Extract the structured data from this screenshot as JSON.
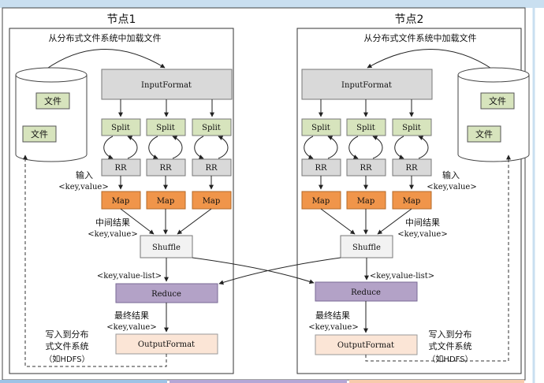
{
  "colors": {
    "header_band": "#c9dff0",
    "split_fill": "#d7e4bd",
    "rr_fill": "#d9d9d9",
    "map_fill": "#f0954a",
    "shuffle_fill": "#f2f2f2",
    "reduce_fill": "#b3a2c7",
    "output_fill": "#fbe5d6",
    "inputformat_fill": "#d9d9d9",
    "file_fill": "#d7e4bd",
    "footer_bands": [
      "#9dc3e6",
      "#b4a7d6",
      "#f8cbad"
    ]
  },
  "node1": {
    "title": "节点1",
    "load_label": "从分布式文件系统中加载文件",
    "inputformat": "InputFormat",
    "files": [
      "文件",
      "文件"
    ],
    "splits": [
      "Split",
      "Split",
      "Split"
    ],
    "rrs": [
      "RR",
      "RR",
      "RR"
    ],
    "maps": [
      "Map",
      "Map",
      "Map"
    ],
    "input_label": "输入",
    "input_kv": "<key,value>",
    "mid_label": "中间结果",
    "mid_kv": "<key,value>",
    "shuffle": "Shuffle",
    "kvlist": "<key,value-list>",
    "reduce": "Reduce",
    "final_label": "最终结果",
    "final_kv": "<key,value>",
    "outputformat": "OutputFormat",
    "write_lines": [
      "写入到分布",
      "式文件系统",
      "（如HDFS）"
    ]
  },
  "node2": {
    "title": "节点2",
    "load_label": "从分布式文件系统中加载文件",
    "inputformat": "InputFormat",
    "files": [
      "文件",
      "文件"
    ],
    "splits": [
      "Split",
      "Split",
      "Split"
    ],
    "rrs": [
      "RR",
      "RR",
      "RR"
    ],
    "maps": [
      "Map",
      "Map",
      "Map"
    ],
    "input_label": "输入",
    "input_kv": "<key,value>",
    "mid_label": "中间结果",
    "mid_kv": "<key,value>",
    "shuffle": "Shuffle",
    "kvlist": "<key,value-list>",
    "reduce": "Reduce",
    "final_label": "最终结果",
    "final_kv": "<key,value>",
    "outputformat": "OutputFormat",
    "write_lines": [
      "写入到分布",
      "式文件系统",
      "（如HDFS）"
    ]
  }
}
